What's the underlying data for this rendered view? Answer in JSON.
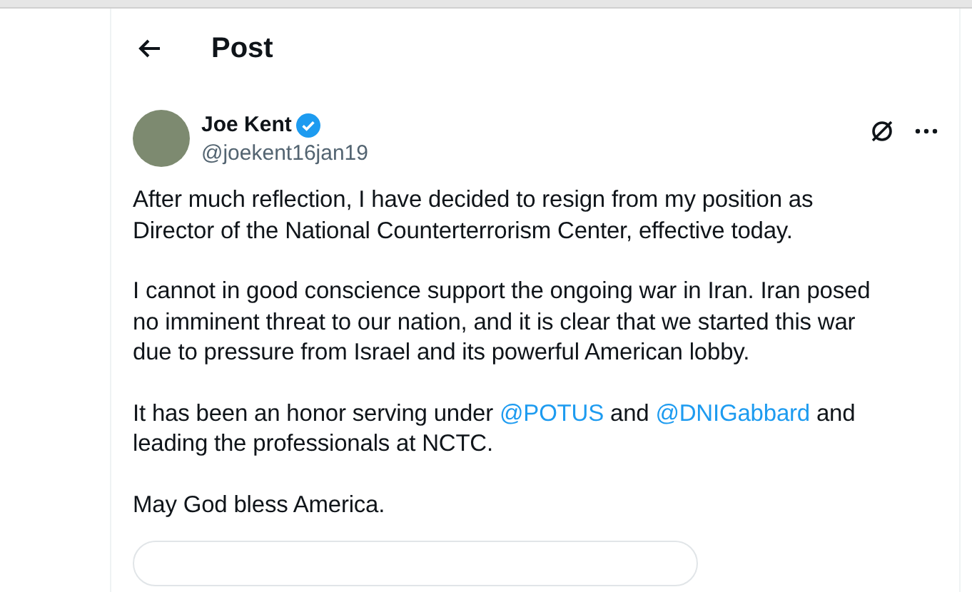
{
  "header": {
    "title": "Post"
  },
  "post": {
    "author": {
      "name": "Joe Kent",
      "verified": true,
      "handle": "@joekent16jan19"
    },
    "paragraphs": [
      [
        {
          "kind": "text",
          "text": "After much reflection, I have decided to resign from my position as Director of the National Counterterrorism Center, effective today."
        }
      ],
      [
        {
          "kind": "text",
          "text": "I cannot in good conscience support the ongoing war in Iran. Iran posed no imminent threat to our nation, and it is clear that we started this war due to pressure from Israel and its powerful American lobby."
        }
      ],
      [
        {
          "kind": "text",
          "text": "It has been an honor serving under "
        },
        {
          "kind": "mention",
          "text": "@POTUS"
        },
        {
          "kind": "text",
          "text": " and "
        },
        {
          "kind": "mention",
          "text": "@DNIGabbard"
        },
        {
          "kind": "text",
          "text": " and leading the professionals at NCTC."
        }
      ],
      [
        {
          "kind": "text",
          "text": "May God bless America."
        }
      ]
    ]
  }
}
